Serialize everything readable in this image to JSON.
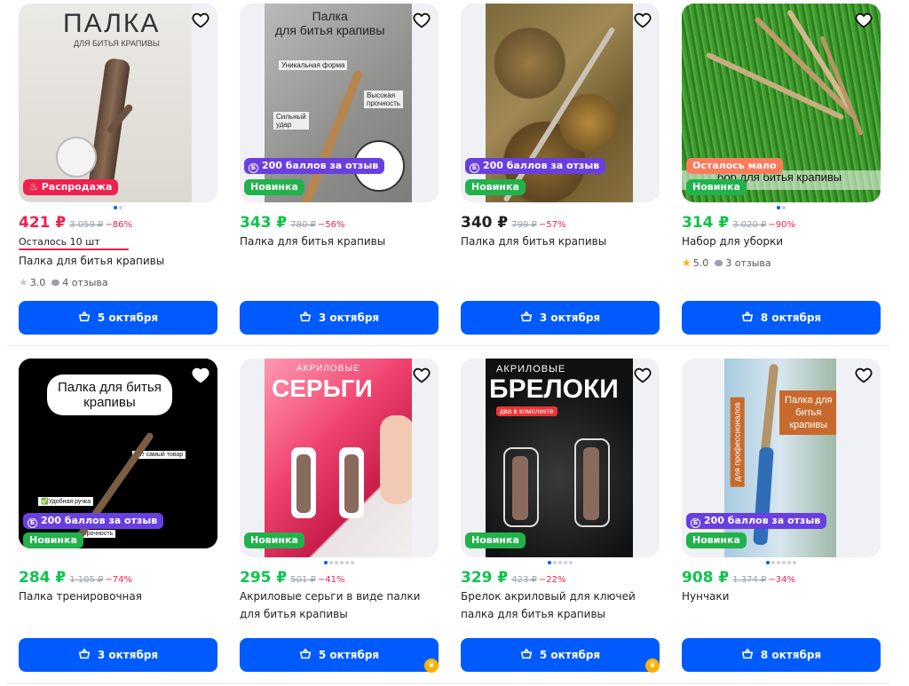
{
  "products": [
    {
      "price": "421 ₽",
      "old_price": "3 059 ₽",
      "discount": "−86%",
      "stock": "Осталось 10 шт",
      "title": "Палка для битья крапивы",
      "rating": "3.0",
      "reviews": "4 отзыва",
      "delivery": "5 октября",
      "badges": [
        "Распродажа"
      ],
      "image_text": {
        "headline": "ПАЛКА",
        "sub": "ДЛЯ БИТЬЯ КРАПИВЫ"
      }
    },
    {
      "price": "343 ₽",
      "old_price": "780 ₽",
      "discount": "−56%",
      "title": "Палка для битья крапивы",
      "delivery": "3 октября",
      "badges": [
        "200 баллов за отзыв",
        "Новинка"
      ],
      "image_text": {
        "headline": "Палка\nдля битья крапивы",
        "l1": "Уникальная форма",
        "l2": "Высокая\nпрочность",
        "l3": "Сильный\nудар"
      }
    },
    {
      "price": "340 ₽",
      "old_price": "799 ₽",
      "discount": "−57%",
      "title": "Палка для битья крапивы",
      "delivery": "3 октября",
      "badges": [
        "200 баллов за отзыв",
        "Новинка"
      ]
    },
    {
      "price": "314 ₽",
      "old_price": "3 020 ₽",
      "discount": "−90%",
      "title": "Набор для уборки",
      "rating": "5.0",
      "reviews": "3 отзыва",
      "delivery": "8 октября",
      "badges": [
        "Осталось мало",
        "Новинка"
      ],
      "image_text": {
        "caption": "бор для битья крапивы"
      }
    },
    {
      "price": "284 ₽",
      "old_price": "1 105 ₽",
      "discount": "−74%",
      "title": "Палка тренировочная",
      "delivery": "3 октября",
      "badges": [
        "200 баллов за отзыв",
        "Новинка"
      ],
      "image_text": {
        "headline": "Палка для битья\nкрапивы",
        "l1": "Тот самый товар",
        "l2": "✅Удобная ручка",
        "l3": "прочность"
      }
    },
    {
      "price": "295 ₽",
      "old_price": "501 ₽",
      "discount": "−41%",
      "title": "Акриловые серьги в виде палки для битья крапивы",
      "delivery": "5 октября",
      "badges": [
        "Новинка"
      ],
      "image_text": {
        "headline": "СЕРЬГИ",
        "sub": "АКРИЛОВЫЕ"
      }
    },
    {
      "price": "329 ₽",
      "old_price": "423 ₽",
      "discount": "−22%",
      "title": "Брелок акриловый для ключей палка для битья крапивы",
      "delivery": "5 октября",
      "badges": [
        "Новинка"
      ],
      "image_text": {
        "headline": "БРЕЛОКИ",
        "sub": "АКРИЛОВЫЕ",
        "tag": "два в комплекте"
      }
    },
    {
      "price": "908 ₽",
      "old_price": "1 374 ₽",
      "discount": "−34%",
      "title": "Нунчаки",
      "delivery": "8 октября",
      "badges": [
        "200 баллов за отзыв",
        "Новинка"
      ],
      "image_text": {
        "headline": "Палка для\nбитья\nкрапивы",
        "side": "для профессионалов"
      }
    }
  ],
  "colors": {
    "accent": "#005bff",
    "sale": "#f0214e",
    "new": "#22b24c",
    "points": "#6a3fe0",
    "price_green": "#10c44c"
  }
}
